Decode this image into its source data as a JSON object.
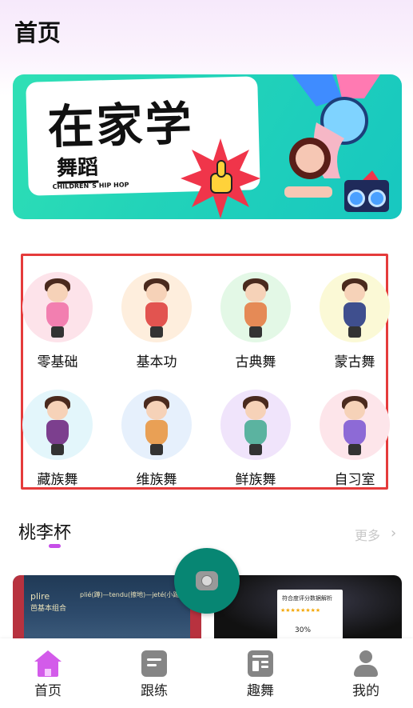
{
  "header": {
    "title": "首页"
  },
  "banner": {
    "main_text": "在家学",
    "sub_text": "舞蹈",
    "english_text": "CHILDREN`S HIP HOP"
  },
  "categories": [
    {
      "label": "零基础",
      "icon": "ballerina-icon",
      "bg": "#fde3ea",
      "outfit": "#f27fb0"
    },
    {
      "label": "基本功",
      "icon": "basic-skill-dancer-icon",
      "bg": "#feeedd",
      "outfit": "#e25450"
    },
    {
      "label": "古典舞",
      "icon": "classical-dancer-icon",
      "bg": "#e3f8e6",
      "outfit": "#e58a56"
    },
    {
      "label": "蒙古舞",
      "icon": "mongolian-dancer-icon",
      "bg": "#fbf9d6",
      "outfit": "#3f4f8e"
    },
    {
      "label": "藏族舞",
      "icon": "tibetan-dancer-icon",
      "bg": "#e3f6fb",
      "outfit": "#7c3f8e"
    },
    {
      "label": "维族舞",
      "icon": "uyghur-dancer-icon",
      "bg": "#e6f0fc",
      "outfit": "#e9a055"
    },
    {
      "label": "鲜族舞",
      "icon": "korean-dancer-icon",
      "bg": "#f0e4fb",
      "outfit": "#5bb3a0"
    },
    {
      "label": "自习室",
      "icon": "study-room-dancers-icon",
      "bg": "#fde5ea",
      "outfit": "#8d6ad6"
    }
  ],
  "section": {
    "title": "桃李杯",
    "more_label": "更多"
  },
  "thumbnails": [
    {
      "name": "ballet-thumbnail",
      "text_1": "plire",
      "text_2": "芭基本组合",
      "text_3": "plié(蹲)—tendu(擦地)—jeté(小踢腿)"
    },
    {
      "name": "score-thumbnail",
      "card_title": "符合度评分数据解析",
      "stars": "★★★★★★★★",
      "percent": "30%"
    }
  ],
  "bottom_nav": [
    {
      "label": "首页",
      "icon": "home-icon",
      "active": true
    },
    {
      "label": "跟练",
      "icon": "practice-icon",
      "active": false
    },
    {
      "label": "趣舞",
      "icon": "fun-dance-icon",
      "active": false
    },
    {
      "label": "我的",
      "icon": "profile-icon",
      "active": false
    }
  ],
  "colors": {
    "accent": "#d35bea",
    "fab": "#078673",
    "highlight_frame": "#e53b3b"
  }
}
